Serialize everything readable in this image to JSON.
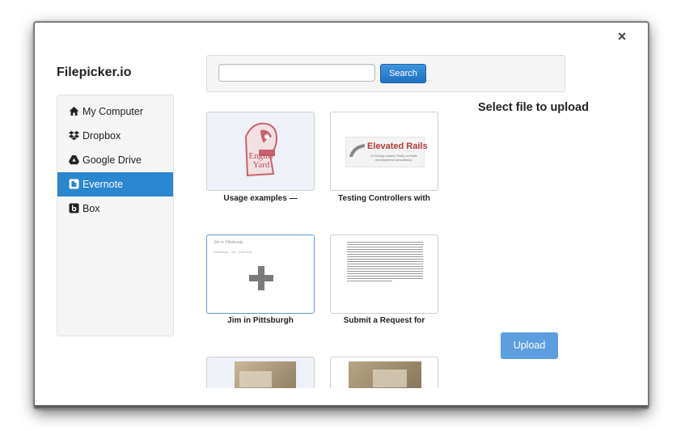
{
  "dialog": {
    "close_label": "×"
  },
  "brand": "Filepicker.io",
  "sidebar": {
    "items": [
      {
        "label": "My Computer",
        "icon": "home-icon"
      },
      {
        "label": "Dropbox",
        "icon": "dropbox-icon"
      },
      {
        "label": "Google Drive",
        "icon": "google-drive-icon"
      },
      {
        "label": "Evernote",
        "icon": "evernote-icon",
        "active": true
      },
      {
        "label": "Box",
        "icon": "box-icon"
      }
    ]
  },
  "search": {
    "value": "",
    "placeholder": "",
    "button_label": "Search"
  },
  "main": {
    "title": "Select file to upload"
  },
  "files": [
    {
      "caption": "Usage examples —",
      "thumb_text": [
        "Engine",
        "Yard"
      ]
    },
    {
      "caption": "Testing Controllers with",
      "thumb_text": [
        "Elevated Rails",
        "A Chicago-based, Ruby on Rails development consultancy."
      ]
    },
    {
      "caption": "Jim in Pittsburgh",
      "thumb_text": [
        "Jim in Pittsburgh",
        "Pittsburgh - Jim - Evernote"
      ]
    },
    {
      "caption": "Submit a Request for"
    },
    {
      "caption": ""
    },
    {
      "caption": ""
    }
  ],
  "upload_label": "Upload",
  "colors": {
    "accent": "#2a86cf",
    "upload": "#5c9ee0"
  }
}
